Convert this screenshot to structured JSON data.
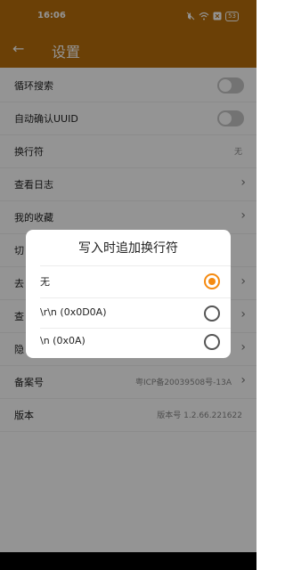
{
  "status": {
    "time": "16:06",
    "battery": "53"
  },
  "appbar": {
    "back_glyph": "←",
    "title": "设置"
  },
  "settings": {
    "items": [
      {
        "label": "循环搜索"
      },
      {
        "label": "自动确认UUID"
      },
      {
        "label": "换行符",
        "value": "无"
      },
      {
        "label": "查看日志"
      },
      {
        "label": "我的收藏"
      },
      {
        "label": "切"
      },
      {
        "label": "去"
      },
      {
        "label": "查"
      },
      {
        "label": "隐"
      },
      {
        "label": "备案号",
        "value": "粤ICP备20039508号-13A"
      },
      {
        "label": "版本",
        "value": "版本号 1.2.66.221622"
      }
    ],
    "chevron": "›"
  },
  "dialog": {
    "title": "写入时追加换行符",
    "options": [
      "无",
      "\\r\\n (0x0D0A)",
      "\\n (0x0A)"
    ],
    "selected_index": 0
  },
  "colors": {
    "primary": "#b86f0b",
    "accent": "#f58a10"
  }
}
